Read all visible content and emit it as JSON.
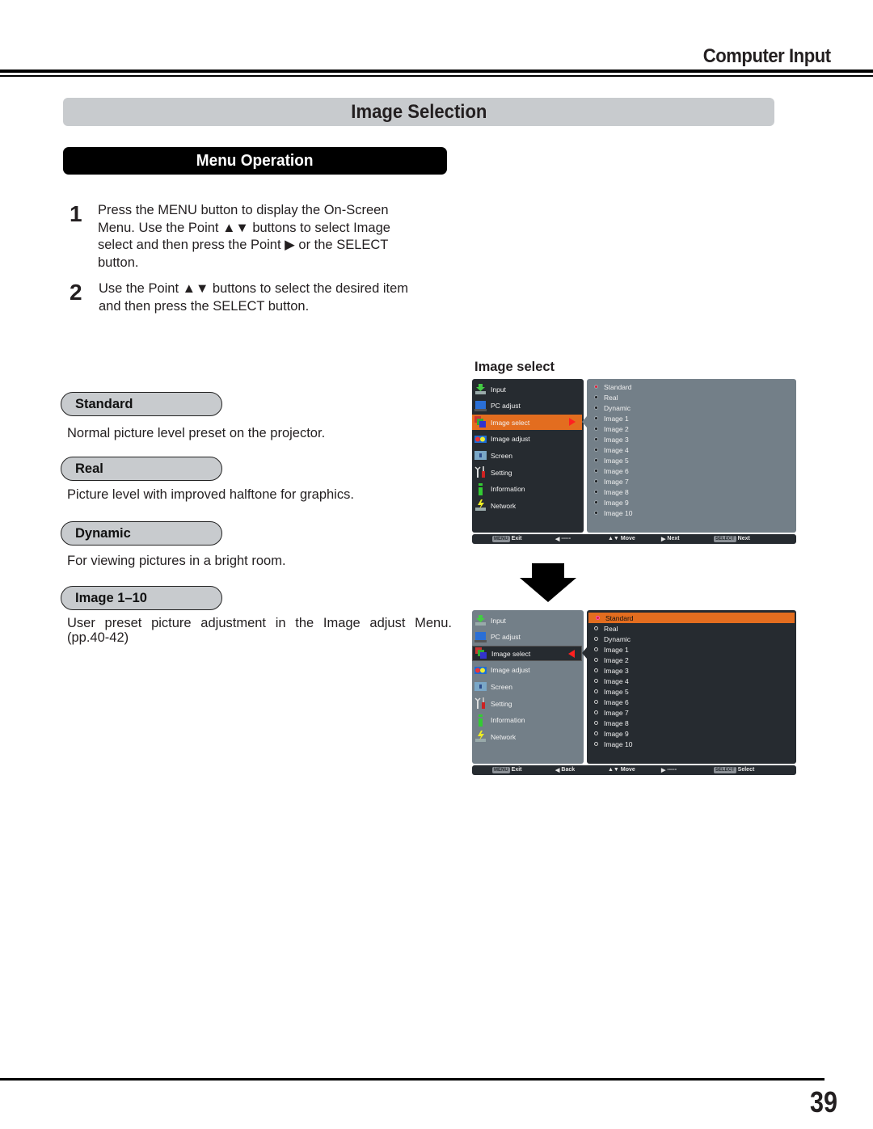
{
  "header": {
    "chapter_title": "Computer Input"
  },
  "section": {
    "title": "Image Selection",
    "subsection_title": "Menu Operation"
  },
  "steps": [
    {
      "number": "1",
      "lines": [
        "Press the MENU button to display the On-Screen",
        "Menu. Use the Point ▲▼ buttons to select Image",
        "select and then press the Point ▶ or the SELECT",
        "button."
      ]
    },
    {
      "number": "2",
      "lines": [
        "Use the Point ▲▼ buttons to select the desired item",
        "and then press the SELECT button."
      ]
    }
  ],
  "options": [
    {
      "label": "Standard",
      "description": "Normal picture level preset on the projector."
    },
    {
      "label": "Real",
      "description": "Picture level with improved halftone for graphics."
    },
    {
      "label": "Dynamic",
      "description": "For viewing pictures in a bright room."
    },
    {
      "label": "Image 1–10",
      "description": "User preset picture adjustment in the Image adjust Menu.",
      "description_line2": "(pp.40-42)"
    }
  ],
  "osd_caption": "Image select",
  "osd_menu": {
    "main_items": [
      {
        "label": "Input",
        "icon": "input-icon"
      },
      {
        "label": "PC adjust",
        "icon": "pc-adjust-icon"
      },
      {
        "label": "Image select",
        "icon": "image-select-icon"
      },
      {
        "label": "Image adjust",
        "icon": "image-adjust-icon"
      },
      {
        "label": "Screen",
        "icon": "screen-icon"
      },
      {
        "label": "Setting",
        "icon": "setting-icon"
      },
      {
        "label": "Information",
        "icon": "information-icon"
      },
      {
        "label": "Network",
        "icon": "network-icon"
      }
    ],
    "sub_items": [
      "Standard",
      "Real",
      "Dynamic",
      "Image 1",
      "Image 2",
      "Image 3",
      "Image 4",
      "Image 5",
      "Image 6",
      "Image 7",
      "Image 8",
      "Image 9",
      "Image 10"
    ],
    "selected_main": "Image select",
    "selected_sub": "Standard",
    "colors": {
      "highlight": "#e36d1f",
      "panel_light": "#737f88",
      "panel_dark": "#262b30",
      "arrow": "#ff2020",
      "selected_dot": "#e0203a"
    },
    "screen1_bar": [
      {
        "key": "MENU",
        "label": "Exit"
      },
      {
        "key": "◀",
        "label": "-----"
      },
      {
        "key": "▲▼",
        "label": "Move"
      },
      {
        "key": "▶",
        "label": "Next"
      },
      {
        "key": "SELECT",
        "label": "Next"
      }
    ],
    "screen2_bar": [
      {
        "key": "MENU",
        "label": "Exit"
      },
      {
        "key": "◀",
        "label": "Back"
      },
      {
        "key": "▲▼",
        "label": "Move"
      },
      {
        "key": "▶",
        "label": "-----"
      },
      {
        "key": "SELECT",
        "label": "Select"
      }
    ]
  },
  "footer": {
    "page_number": "39"
  }
}
